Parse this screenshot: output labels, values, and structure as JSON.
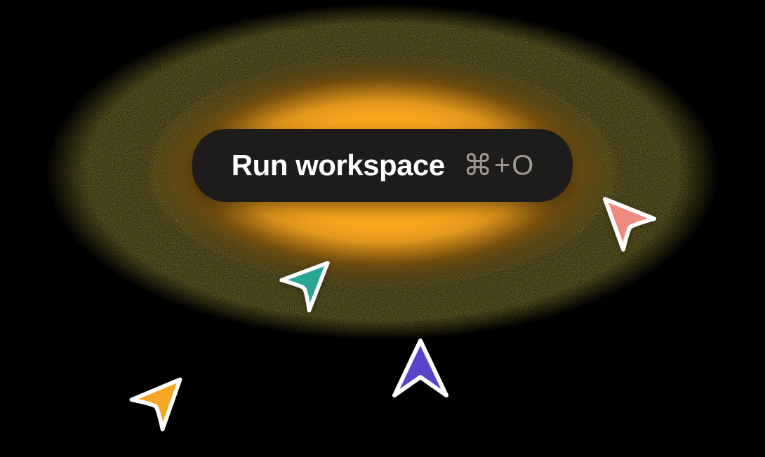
{
  "button": {
    "label": "Run workspace",
    "shortcut_symbol": "⌘",
    "shortcut_plus": "+",
    "shortcut_key": "O"
  },
  "cursors": {
    "pink": {
      "color": "#ef8a7f"
    },
    "teal": {
      "color": "#2aa793"
    },
    "purple": {
      "color": "#5b44c9"
    },
    "orange": {
      "color": "#f5a623"
    }
  },
  "glow_color": "#f5a623"
}
